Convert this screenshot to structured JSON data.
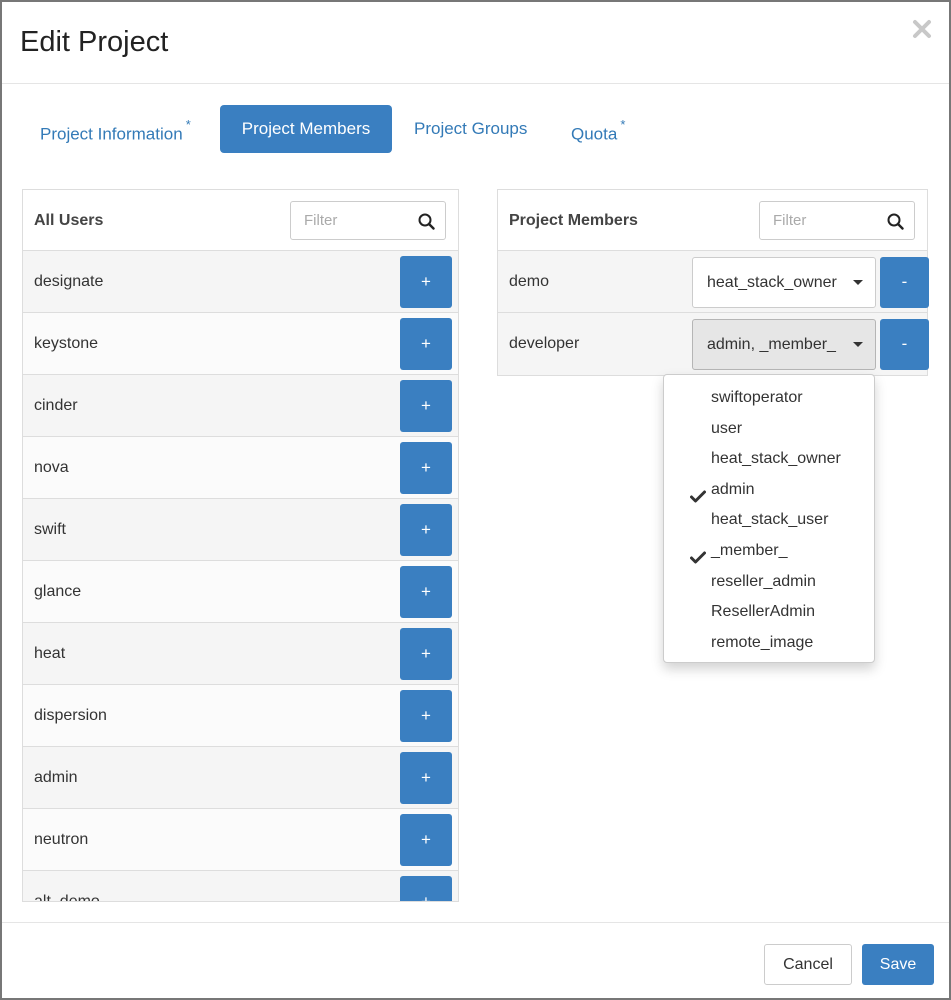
{
  "dialog": {
    "title": "Edit Project",
    "close_icon": "close-icon"
  },
  "tabs": [
    {
      "label": "Project Information",
      "required_mark": "*",
      "active": false
    },
    {
      "label": "Project Members",
      "required_mark": "",
      "active": true
    },
    {
      "label": "Project Groups",
      "required_mark": "",
      "active": false
    },
    {
      "label": "Quota",
      "required_mark": "*",
      "active": false
    }
  ],
  "all_users": {
    "title": "All Users",
    "filter_placeholder": "Filter",
    "add_label": "+",
    "users": [
      "designate",
      "keystone",
      "cinder",
      "nova",
      "swift",
      "glance",
      "heat",
      "dispersion",
      "admin",
      "neutron",
      "alt_demo"
    ]
  },
  "project_members": {
    "title": "Project Members",
    "filter_placeholder": "Filter",
    "remove_label": "-",
    "members": [
      {
        "name": "demo",
        "roles": "heat_stack_owner"
      },
      {
        "name": "developer",
        "roles": "admin, _member_"
      }
    ]
  },
  "role_dropdown": {
    "options": [
      {
        "label": "swiftoperator",
        "checked": false
      },
      {
        "label": "user",
        "checked": false
      },
      {
        "label": "heat_stack_owner",
        "checked": false
      },
      {
        "label": "admin",
        "checked": true
      },
      {
        "label": "heat_stack_user",
        "checked": false
      },
      {
        "label": "_member_",
        "checked": true
      },
      {
        "label": "reseller_admin",
        "checked": false
      },
      {
        "label": "ResellerAdmin",
        "checked": false
      },
      {
        "label": "remote_image",
        "checked": false
      }
    ]
  },
  "footer": {
    "cancel_label": "Cancel",
    "save_label": "Save"
  },
  "colors": {
    "primary": "#3a7fc1",
    "link": "#337ab7"
  }
}
